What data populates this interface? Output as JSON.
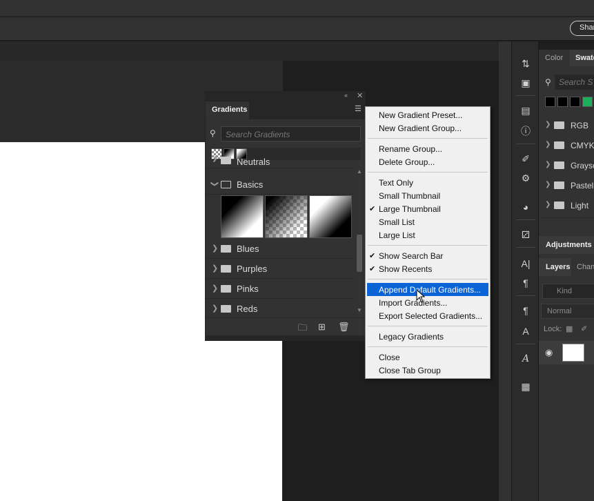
{
  "topbar": {
    "share_label": "Shar"
  },
  "gradients_panel": {
    "tab_label": "Gradients",
    "search_placeholder": "Search Gradients",
    "partial_row_label": "Neutrals",
    "expanded_group": "Basics",
    "groups": [
      "Blues",
      "Purples",
      "Pinks",
      "Reds"
    ]
  },
  "context_menu": {
    "items": [
      {
        "label": "New Gradient Preset...",
        "checked": false
      },
      {
        "label": "New Gradient Group...",
        "checked": false
      },
      {
        "label": "Rename Group...",
        "checked": false
      },
      {
        "label": "Delete Group...",
        "checked": false
      },
      {
        "label": "Text Only",
        "checked": false
      },
      {
        "label": "Small Thumbnail",
        "checked": false
      },
      {
        "label": "Large Thumbnail",
        "checked": true
      },
      {
        "label": "Small List",
        "checked": false
      },
      {
        "label": "Large List",
        "checked": false
      },
      {
        "label": "Show Search Bar",
        "checked": true
      },
      {
        "label": "Show Recents",
        "checked": true
      },
      {
        "label": "Append Default Gradients...",
        "checked": false,
        "highlighted": true
      },
      {
        "label": "Import Gradients...",
        "checked": false
      },
      {
        "label": "Export Selected Gradients...",
        "checked": false
      },
      {
        "label": "Legacy Gradients",
        "checked": false
      },
      {
        "label": "Close",
        "checked": false
      },
      {
        "label": "Close Tab Group",
        "checked": false
      }
    ]
  },
  "right_panel": {
    "tabs": {
      "color": "Color",
      "swatches": "Swatc"
    },
    "search_placeholder": "Search S",
    "swatch_folders": [
      "RGB",
      "CMYK",
      "Graysc",
      "Pastel",
      "Light"
    ],
    "adjustments_label": "Adjustments",
    "layers_tab": "Layers",
    "channels_tab": "Chan",
    "kind_placeholder": "Kind",
    "blend_mode": "Normal",
    "lock_label": "Lock:"
  },
  "colors": {
    "accent": "#0a64d6",
    "swatch_green": "#1ab05a"
  }
}
